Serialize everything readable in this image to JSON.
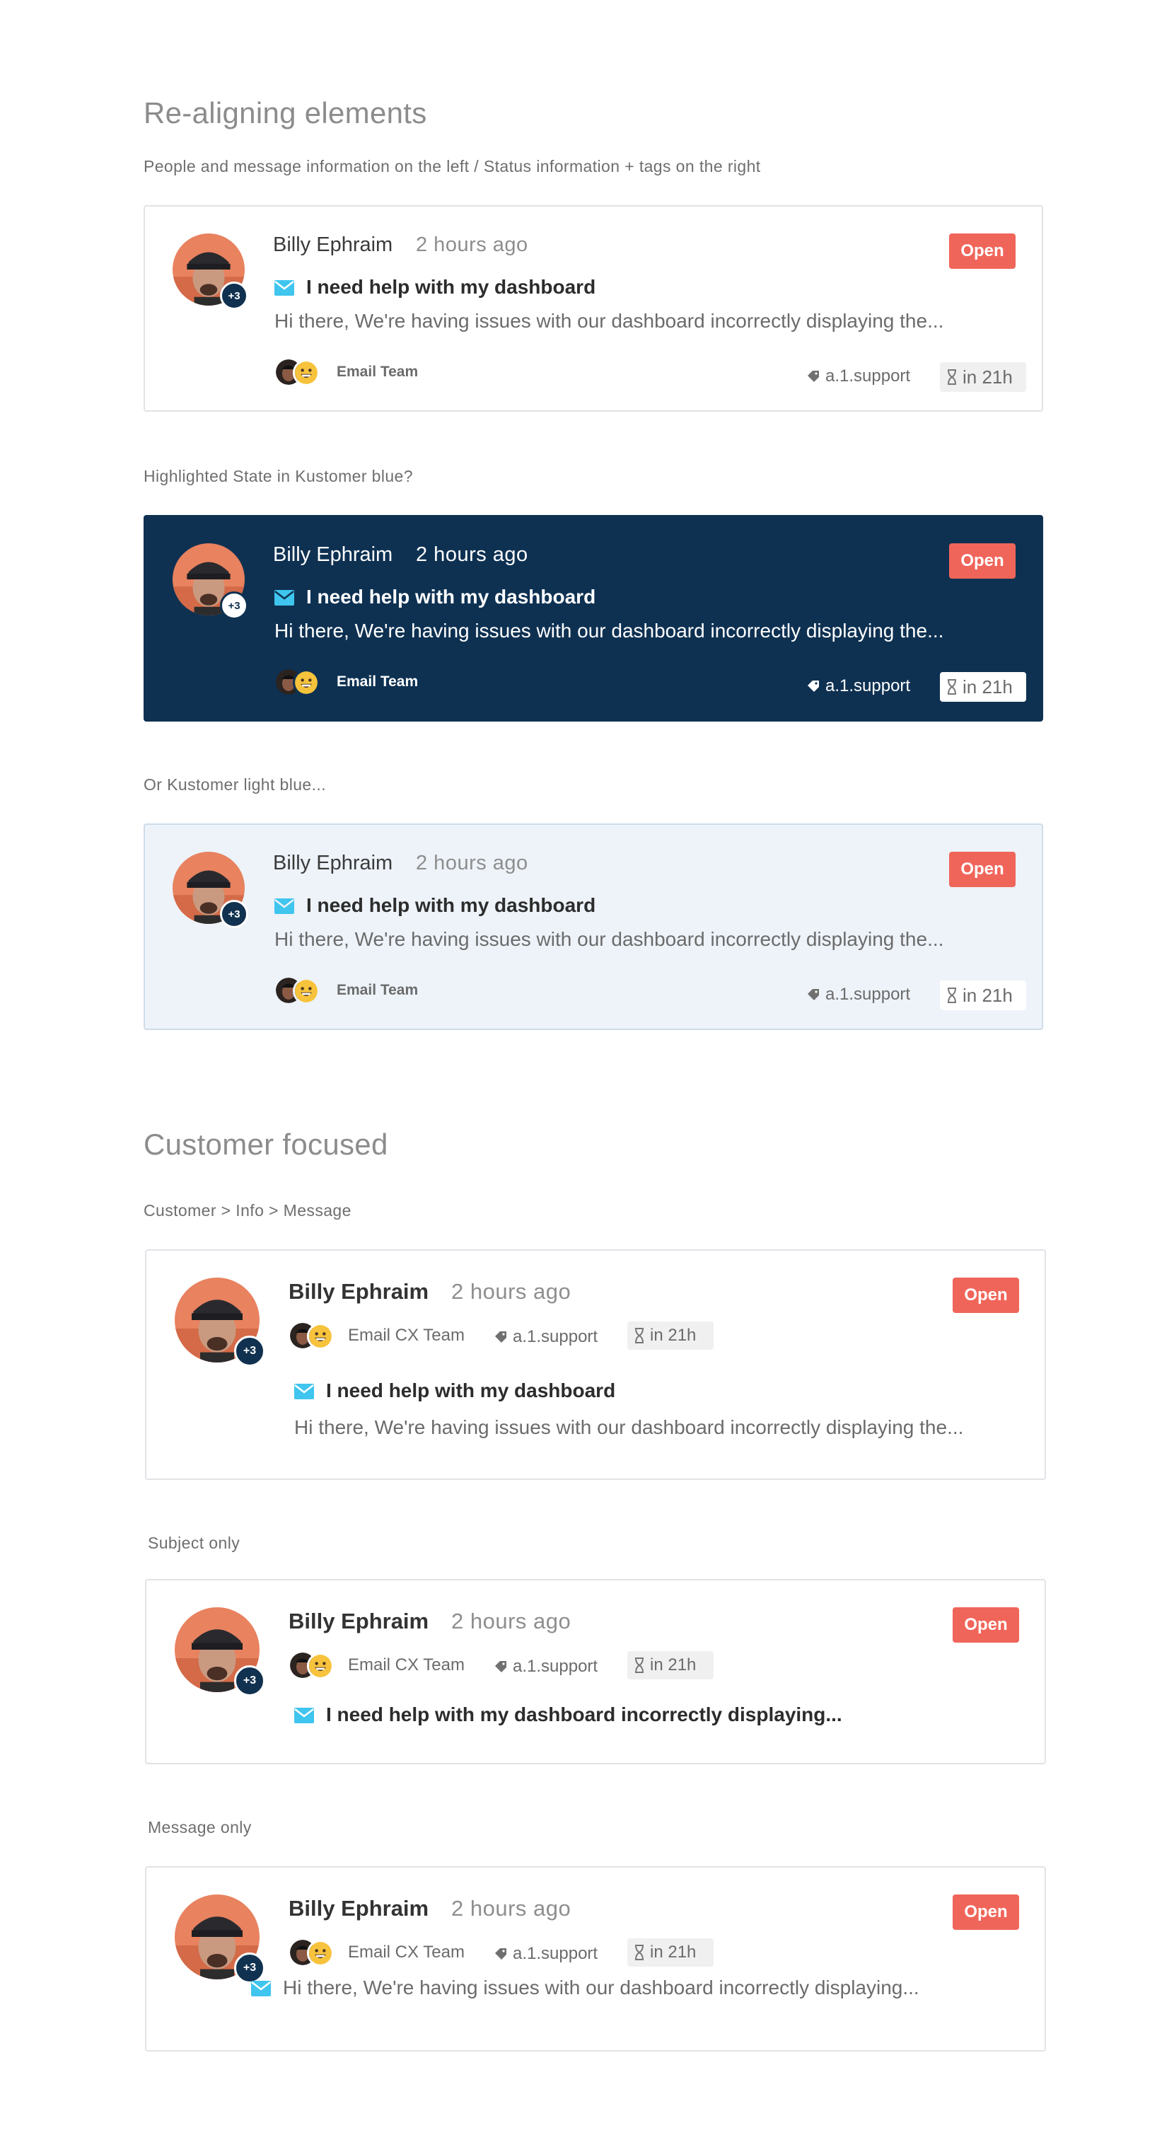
{
  "sections": {
    "realign_title": "Re-aligning elements",
    "realign_caption": "People and message information on the left / Status information + tags on the right",
    "highlighted_caption": "Highlighted State in Kustomer blue?",
    "lightblue_caption": "Or Kustomer light blue...",
    "customer_title": "Customer focused",
    "customer_caption": "Customer > Info > Message",
    "subject_caption": "Subject only",
    "message_caption": "Message only"
  },
  "conversation": {
    "customer_name": "Billy Ephraim",
    "time_ago": "2 hours ago",
    "status": "Open",
    "participant_count": "+3",
    "subject": "I need help with my dashboard",
    "subject_long": "I need help with my dashboard incorrectly displaying...",
    "preview": "Hi there, We're having issues with our dashboard incorrectly displaying the...",
    "preview_short": "Hi there, We're having issues with our dashboard incorrectly displaying...",
    "team": "Email Team",
    "team_cx": "Email CX Team",
    "tag": "a.1.support",
    "sla": "in 21h"
  },
  "colors": {
    "status_open": "#f0655a",
    "highlight_blue": "#0e3152",
    "light_blue": "#edf3f9",
    "mail_icon": "#3fc5ee"
  }
}
